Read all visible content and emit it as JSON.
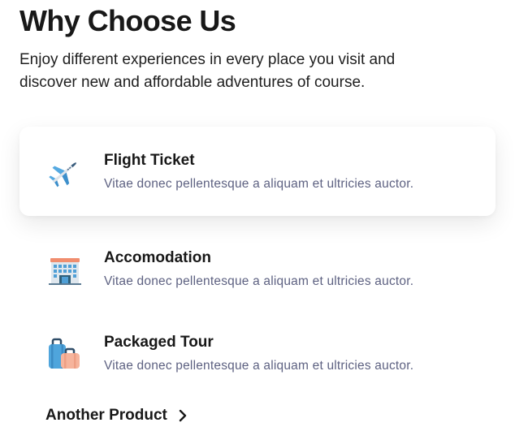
{
  "header": {
    "title": "Why Choose Us",
    "subtitle": "Enjoy different experiences in every place you visit and discover new and affordable adventures of course."
  },
  "features": [
    {
      "icon": "airplane-icon",
      "title": "Flight Ticket",
      "description": "Vitae donec pellentesque a aliquam et ultricies auctor.",
      "active": true
    },
    {
      "icon": "hotel-building-icon",
      "title": "Accomodation",
      "description": "Vitae donec pellentesque a aliquam et ultricies auctor.",
      "active": false
    },
    {
      "icon": "luggage-icon",
      "title": "Packaged Tour",
      "description": "Vitae donec pellentesque a aliquam et ultricies auctor.",
      "active": false
    }
  ],
  "footer_link": {
    "label": "Another Product",
    "icon": "chevron-right-icon"
  },
  "colors": {
    "text_primary": "#181818",
    "text_secondary": "#5e6282",
    "card_background": "#ffffff"
  }
}
